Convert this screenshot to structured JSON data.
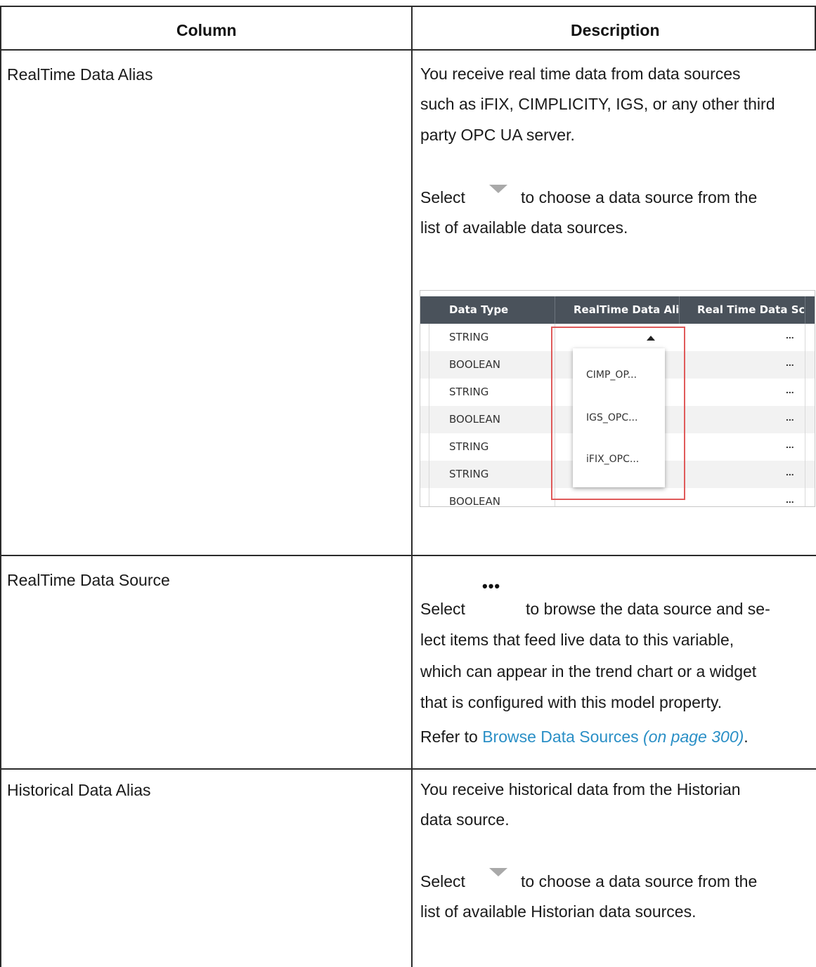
{
  "table": {
    "headers": {
      "column": "Column",
      "description": "Description"
    },
    "rows": [
      {
        "name": "RealTime Data Alias",
        "p1": [
          "You receive real time data from data sources",
          "such as iFIX, CIMPLICITY, IGS, or any other third",
          "party OPC UA server."
        ],
        "select_word": "Select",
        "select_rest": "to choose a data source from the",
        "select_line2": "list of available data sources."
      },
      {
        "name": "RealTime Data Source",
        "select_word": "Select",
        "select_rest": "to browse the data source and se-",
        "lines": [
          "lect items that feed live data to this variable,",
          "which can appear in the trend chart or a widget",
          "that is configured with this model property."
        ],
        "refer_prefix": "Refer to",
        "refer_link": "Browse Data Sources",
        "refer_page": "(on page 300)",
        "refer_end": "."
      },
      {
        "name": "Historical Data Alias",
        "p1": [
          "You receive historical data from the Historian",
          "data source."
        ],
        "select_word": "Select",
        "select_rest": "to choose a data source from the",
        "select_line2": "list of available Historian data sources."
      }
    ]
  },
  "screenshot": {
    "headers": [
      "Data Type",
      "RealTime Data Ali",
      "Real Time Data Sc"
    ],
    "rows": [
      "STRING",
      "BOOLEAN",
      "STRING",
      "BOOLEAN",
      "STRING",
      "STRING",
      "BOOLEAN"
    ],
    "ellipsis": "...",
    "dropdown_options": [
      "CIMP_OP...",
      "IGS_OPC...",
      "iFIX_OPC..."
    ],
    "highlight_color": "#e05a5a"
  },
  "icons": {
    "dropdown": "dropdown-triangle-icon",
    "browse": "ellipsis-icon",
    "browse_glyph": "•••"
  }
}
